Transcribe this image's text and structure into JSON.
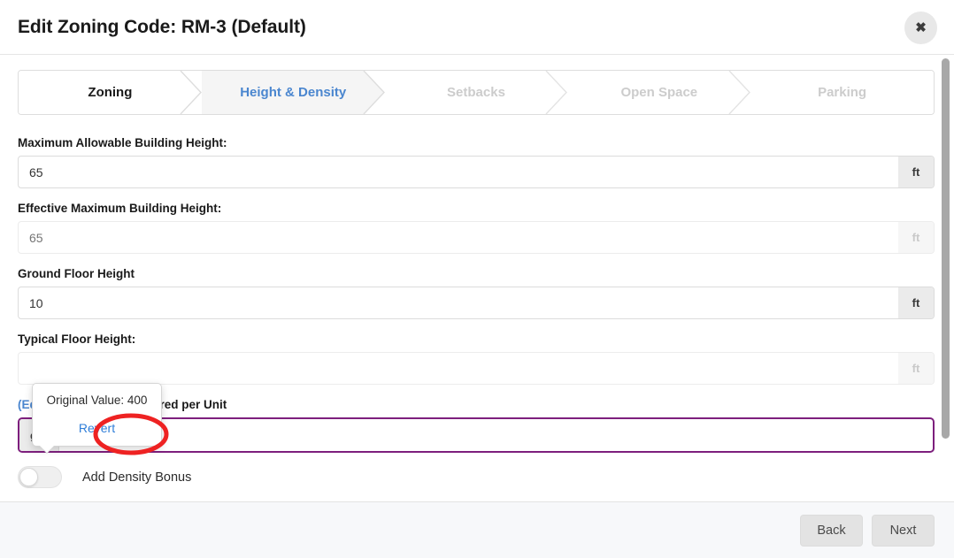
{
  "header": {
    "title": "Edit Zoning Code: RM-3 (Default)",
    "close_label": "✖"
  },
  "tabs": [
    {
      "label": "Zoning",
      "state": "done"
    },
    {
      "label": "Height & Density",
      "state": "active"
    },
    {
      "label": "Setbacks",
      "state": "upcoming"
    },
    {
      "label": "Open Space",
      "state": "upcoming"
    },
    {
      "label": "Parking",
      "state": "upcoming"
    }
  ],
  "fields": [
    {
      "label": "Maximum Allowable Building Height:",
      "value": "65",
      "placeholder": "",
      "unit": "ft",
      "unit_side": "right",
      "disabled": false,
      "edited": false
    },
    {
      "label": "Effective Maximum Building Height:",
      "value": "",
      "placeholder": "65",
      "unit": "ft",
      "unit_side": "right",
      "disabled": true,
      "edited": false
    },
    {
      "label": "Ground Floor Height",
      "value": "10",
      "placeholder": "",
      "unit": "ft",
      "unit_side": "right",
      "disabled": false,
      "edited": false
    },
    {
      "label": "Typical Floor Height:",
      "value": "",
      "placeholder": "",
      "unit": "ft",
      "unit_side": "right",
      "disabled": true,
      "edited": false
    },
    {
      "label": "GSF of Lot Required per Unit",
      "edited_tag": "(Edited)",
      "value": "100",
      "placeholder": "",
      "unit": "gsf",
      "unit_side": "left",
      "disabled": false,
      "edited": true
    }
  ],
  "toggle": {
    "label": "Add Density Bonus",
    "on": false
  },
  "popover": {
    "text": "Original Value: 400",
    "link_label": "Revert"
  },
  "annotation": {
    "shape": "ellipse",
    "color": "#ee2222",
    "target": "Revert"
  },
  "footer": {
    "back_label": "Back",
    "next_label": "Next"
  },
  "colors": {
    "accent_blue": "#4a86cf",
    "link_blue": "#2f7ed8",
    "edited_purple": "#7d1f7d",
    "annotation_red": "#ee2222",
    "tab_inactive": "#cccccc"
  }
}
